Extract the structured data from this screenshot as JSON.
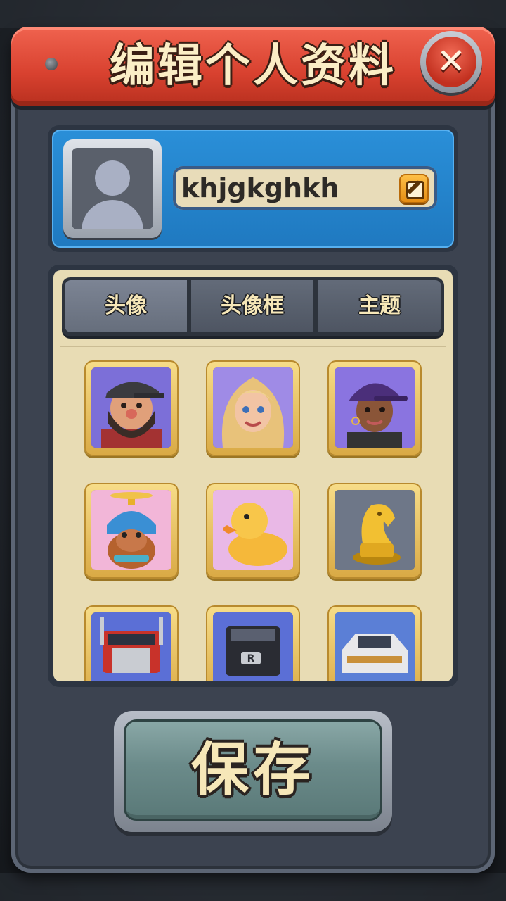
{
  "dialog": {
    "title": "编辑个人资料",
    "close_icon": "close-icon"
  },
  "profile": {
    "avatar_icon": "default-user-icon",
    "username": "khjgkghkh",
    "edit_icon": "edit-icon"
  },
  "tabs": [
    {
      "label": "头像",
      "active": true
    },
    {
      "label": "头像框",
      "active": false
    },
    {
      "label": "主题",
      "active": false
    }
  ],
  "avatars": [
    {
      "name": "bearded-man-avatar",
      "bg": "#7c6fd8"
    },
    {
      "name": "blonde-woman-avatar",
      "bg": "#9f8be6"
    },
    {
      "name": "woman-purple-cap-avatar",
      "bg": "#8a74e0"
    },
    {
      "name": "dog-propeller-helmet-avatar",
      "bg": "#f2b6d8"
    },
    {
      "name": "rubber-duck-avatar",
      "bg": "#e9b8e6"
    },
    {
      "name": "golden-chess-knight-avatar",
      "bg": "#6e7788"
    },
    {
      "name": "red-semi-truck-avatar",
      "bg": "#5b6fd6"
    },
    {
      "name": "black-semi-truck-avatar",
      "bg": "#5b6fd6"
    },
    {
      "name": "white-pickup-truck-avatar",
      "bg": "#5b7fd6"
    }
  ],
  "save_button": {
    "label": "保存"
  }
}
